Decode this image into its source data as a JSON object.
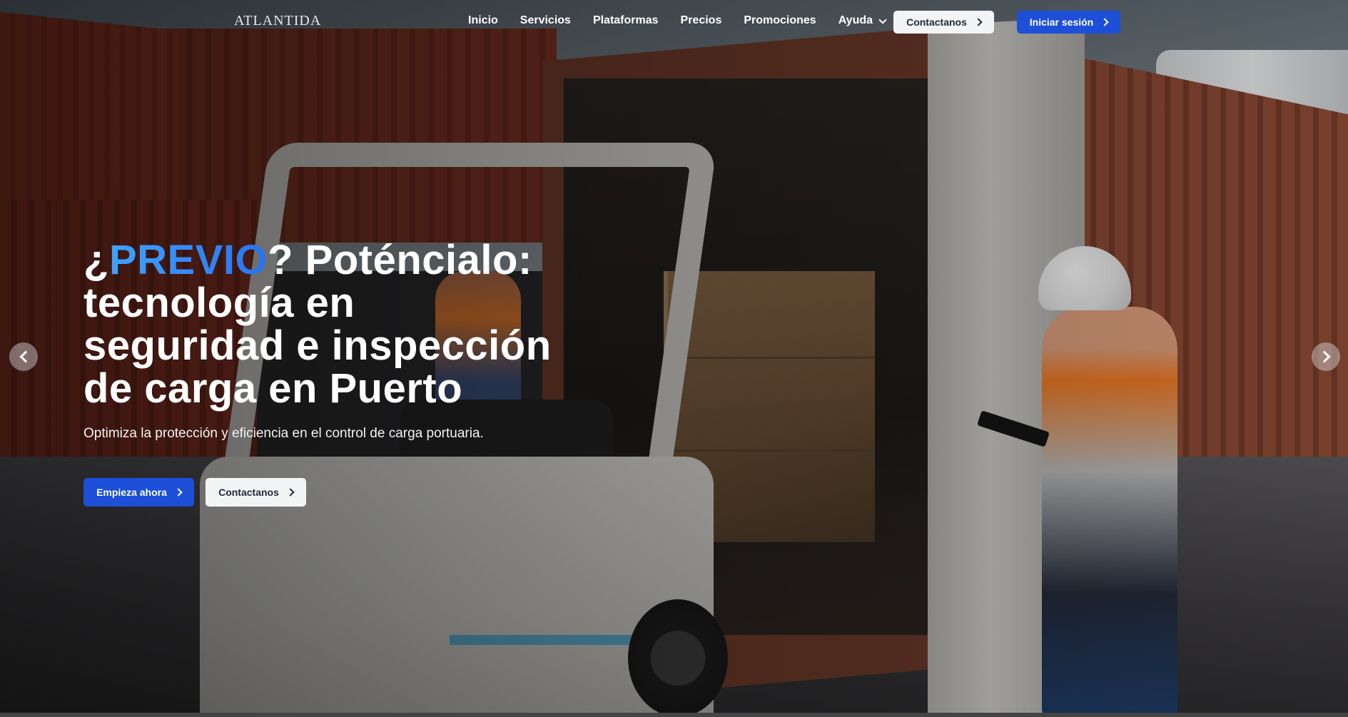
{
  "brand": {
    "logo_text": "ATLANTIDA"
  },
  "nav": {
    "items": [
      "Inicio",
      "Servicios",
      "Plataformas",
      "Precios",
      "Promociones",
      "Ayuda"
    ],
    "contact_label": "Contactanos",
    "login_label": "Iniciar sesión"
  },
  "hero": {
    "headline_open": "¿",
    "headline_accent": "PREVIO",
    "headline_rest_1": "? Poténcialo:",
    "headline_line_2": "tecnología en",
    "headline_line_3": "seguridad e inspección",
    "headline_line_4": "de carga en Puerto",
    "subtitle": "Optimiza la protección y eficiencia en el control de carga portuaria.",
    "cta_primary": "Empieza ahora",
    "cta_secondary": "Contactanos"
  },
  "carousel": {
    "prev_icon": "chevron-left-icon",
    "next_icon": "chevron-right-icon"
  },
  "colors": {
    "accent_blue": "#1d4fd8",
    "headline_accent": "#3ea3ff"
  }
}
